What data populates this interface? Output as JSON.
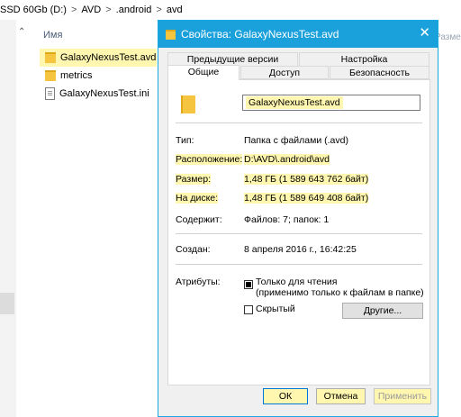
{
  "explorer": {
    "breadcrumb": [
      "SSD 60Gb (D:)",
      ">",
      "AVD",
      ">",
      ".android",
      ">",
      "avd"
    ],
    "column_name": "Имя",
    "column_right_partial": "Разме",
    "files": [
      {
        "name": "GalaxyNexusTest.avd",
        "type": "folder"
      },
      {
        "name": "metrics",
        "type": "folder"
      },
      {
        "name": "GalaxyNexusTest.ini",
        "type": "file"
      }
    ]
  },
  "dialog": {
    "title": "Свойства: GalaxyNexusTest.avd",
    "tabs_top": [
      "Предыдущие версии",
      "Настройка"
    ],
    "tabs_bottom": [
      "Общие",
      "Доступ",
      "Безопасность"
    ],
    "active_tab": "Общие",
    "name_value": "GalaxyNexusTest.avd",
    "props": {
      "type_label": "Тип:",
      "type_value": "Папка с файлами (.avd)",
      "location_label": "Расположение:",
      "location_value": "D:\\AVD\\.android\\avd",
      "size_label": "Размер:",
      "size_value": "1,48 ГБ (1 589 643 762 байт)",
      "disk_label": "На диске:",
      "disk_value": "1,48 ГБ (1 589 649 408 байт)",
      "contains_label": "Содержит:",
      "contains_value": "Файлов: 7; папок: 1",
      "created_label": "Создан:",
      "created_value": "8 апреля 2016 г., 16:42:25",
      "attributes_label": "Атрибуты:",
      "readonly_label": "Только для чтения",
      "readonly_note": "(применимо только к файлам в папке)",
      "readonly_checked": true,
      "hidden_label": "Скрытый",
      "hidden_checked": false,
      "other_button": "Другие..."
    },
    "buttons": {
      "ok": "ОК",
      "cancel": "Отмена",
      "apply": "Применить"
    },
    "close_glyph": "✕"
  },
  "colors": {
    "titlebar": "#1aa0db",
    "highlight": "#fff7b0",
    "folder": "#f5c53f"
  }
}
